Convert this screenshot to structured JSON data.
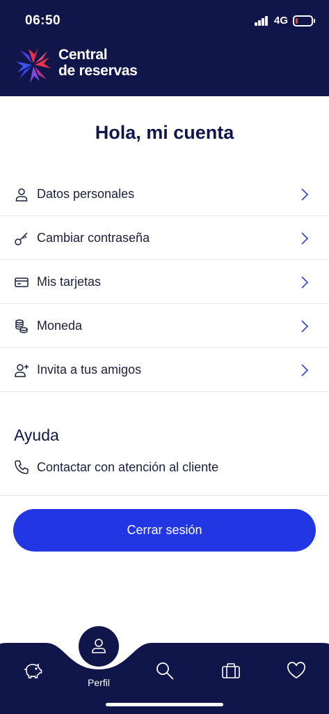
{
  "status_bar": {
    "time": "06:50",
    "network": "4G",
    "battery_level": 0.15,
    "battery_color": "#ff3b30"
  },
  "brand": {
    "line1": "Central",
    "line2": "de reservas"
  },
  "greeting": "Hola, mi cuenta",
  "menu": {
    "items": [
      {
        "label": "Datos personales",
        "icon": "user-icon"
      },
      {
        "label": "Cambiar contraseña",
        "icon": "key-icon"
      },
      {
        "label": "Mis tarjetas",
        "icon": "credit-card-icon"
      },
      {
        "label": "Moneda",
        "icon": "coins-icon"
      },
      {
        "label": "Invita a tus amigos",
        "icon": "user-plus-icon"
      }
    ]
  },
  "help": {
    "title": "Ayuda",
    "contact_label": "Contactar con atención al cliente",
    "contact_icon": "phone-icon"
  },
  "logout_label": "Cerrar sesión",
  "tabbar": {
    "active_label": "Perfil",
    "tabs": [
      "piggy-bank-icon",
      "profile-icon",
      "search-icon",
      "briefcase-icon",
      "heart-icon"
    ]
  },
  "colors": {
    "navy": "#10154a",
    "accent": "#2236e3",
    "chevron": "#3b4ad8"
  }
}
